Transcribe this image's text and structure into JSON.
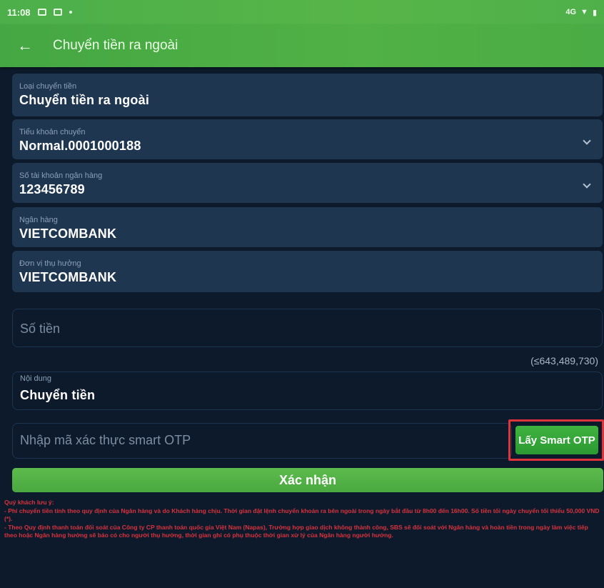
{
  "status_bar": {
    "time": "11:08",
    "right_text": "4G"
  },
  "app_bar": {
    "back_icon": "arrow-left-icon",
    "title": "Chuyển tiền ra ngoài"
  },
  "form": {
    "transfer_type": {
      "label": "Loại chuyển tiền",
      "value": "Chuyển tiền ra ngoài"
    },
    "sub_account": {
      "label": "Tiểu khoản chuyển",
      "value": "Normal.0001000188"
    },
    "bank_account": {
      "label": "Số tài khoản ngân hàng",
      "value": "123456789"
    },
    "bank": {
      "label": "Ngân hàng",
      "value": "VIETCOMBANK"
    },
    "beneficiary": {
      "label": "Đơn vị thụ hưởng",
      "value": "VIETCOMBANK"
    },
    "amount": {
      "placeholder": "Số tiền"
    },
    "balance": "(≤643,489,730)",
    "content": {
      "label": "Nội dung",
      "value": "Chuyển tiền"
    },
    "otp": {
      "placeholder": "Nhập mã xác thực smart OTP",
      "button": "Lấy Smart OTP"
    }
  },
  "confirm_button": "Xác nhận",
  "notes": {
    "title": "Quý khách lưu ý:",
    "line1": "- Phí chuyển tiền tính theo quy định của Ngân hàng và do Khách hàng chịu. Thời gian đặt lệnh chuyển khoản ra bên ngoài trong ngày bắt đầu từ 8h00 đến 16h00. Số tiền tối ngày chuyển tối thiểu 50,000 VND (*).",
    "line2": "- Theo Quy định thanh toán đối soát của Công ty CP thanh toán quốc gia Việt Nam (Napas), Trường hợp giao dịch không thành công, SBS sẽ đối soát với Ngân hàng và hoàn tiền trong ngày làm việc tiếp theo hoặc Ngân hàng hưởng sẽ báo có cho người thụ hưởng, thời gian ghi có phụ thuộc thời gian xử lý của Ngân hàng người hưởng."
  },
  "colors": {
    "header_green": "#4caf4a",
    "background": "#0c1a2b",
    "field_bg": "#1f3651",
    "highlight_red": "#e0343c",
    "note_red": "#d8333d"
  }
}
